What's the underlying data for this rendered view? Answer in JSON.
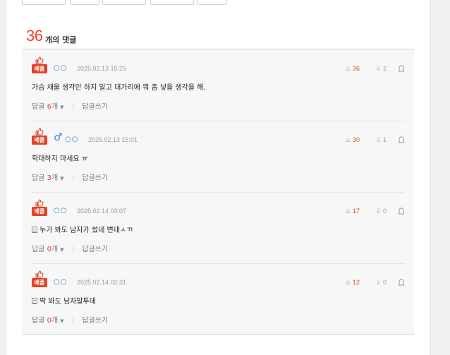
{
  "header": {
    "count": "36",
    "title": "개의 댓글"
  },
  "badge_label": "베플",
  "comments": [
    {
      "nick": "○○",
      "date": "2025.02.13 15:25",
      "likes": "36",
      "dislikes": "2",
      "text": "가슴 채울 생각만 하지 말고 대가리에 뭐 좀 넣을 생각을 해.",
      "reply_count": "6",
      "has_gender": false,
      "has_doc_icon": false
    },
    {
      "nick": "○○",
      "date": "2025.02.13 15:01",
      "likes": "30",
      "dislikes": "1",
      "text": "학대하지 마세요 ㅠ",
      "reply_count": "3",
      "has_gender": true,
      "gender_symbol": "♂",
      "has_doc_icon": false
    },
    {
      "nick": "○○",
      "date": "2025.02.14 03:07",
      "likes": "17",
      "dislikes": "0",
      "text": "누가 봐도 남자가 썼네 변태ㅅㄲ",
      "reply_count": "0",
      "has_gender": false,
      "has_doc_icon": true
    },
    {
      "nick": "○○",
      "date": "2025.02.14 02:31",
      "likes": "12",
      "dislikes": "0",
      "text": "딱 봐도 남자말투데",
      "reply_count": "0",
      "has_gender": false,
      "has_doc_icon": true
    }
  ],
  "labels": {
    "reply": "답글",
    "unit": "개",
    "write_reply": "답글쓰기"
  },
  "colors": {
    "accent": "#e8432d",
    "badge": "#e14226",
    "nick": "#3b6fd0"
  }
}
